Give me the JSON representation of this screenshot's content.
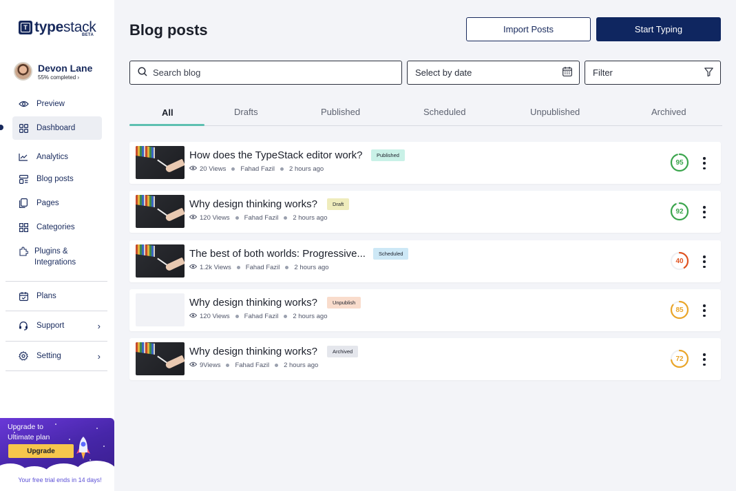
{
  "brand": {
    "name_bold": "type",
    "name_light": "stack",
    "beta": "BETA",
    "logo_letter": "T"
  },
  "profile": {
    "name": "Devon Lane",
    "progress": "55% completed  ›"
  },
  "sidebar": {
    "items": [
      {
        "label": "Preview",
        "icon": "eye-icon"
      },
      {
        "label": "Dashboard",
        "icon": "grid-icon"
      },
      {
        "label": "Analytics",
        "icon": "chart-icon"
      },
      {
        "label": "Blog posts",
        "icon": "blog-icon"
      },
      {
        "label": "Pages",
        "icon": "pages-icon"
      },
      {
        "label": "Categories",
        "icon": "categories-icon"
      },
      {
        "label": "Plugins &\nIntegrations",
        "icon": "plugin-icon"
      },
      {
        "label": "Plans",
        "icon": "calendar-icon"
      },
      {
        "label": "Support",
        "icon": "headset-icon"
      },
      {
        "label": "Setting",
        "icon": "gear-icon"
      }
    ],
    "active": "Dashboard"
  },
  "upgrade": {
    "title": "Upgrade to Ultimate plan",
    "button": "Upgrade",
    "trial": "Your free trial ends in 14 days!"
  },
  "header": {
    "title": "Blog posts",
    "import_label": "Import Posts",
    "start_label": "Start Typing"
  },
  "search": {
    "placeholder": "Search blog"
  },
  "date_select": {
    "label": "Select by date"
  },
  "filter": {
    "label": "Filter"
  },
  "tabs": [
    "All",
    "Drafts",
    "Published",
    "Scheduled",
    "Unpublished",
    "Archived"
  ],
  "active_tab": "All",
  "posts": [
    {
      "title": "How does the TypeStack editor work?",
      "status": "Published",
      "status_color": "#c9f1e7",
      "views": "20 Views",
      "author": "Fahad Fazil",
      "time": "2 hours ago",
      "score": "95",
      "score_value": 95,
      "score_color": "#3aa54c",
      "thumb": true
    },
    {
      "title": "Why design thinking works?",
      "status": "Draft",
      "status_color": "#efecbc",
      "views": "120 Views",
      "author": "Fahad Fazil",
      "time": "2 hours ago",
      "score": "92",
      "score_value": 92,
      "score_color": "#3aa54c",
      "thumb": true
    },
    {
      "title": "The best of both worlds: Progressive...",
      "status": "Scheduled",
      "status_color": "#cde8f6",
      "views": "1.2k Views",
      "author": "Fahad Fazil",
      "time": "2 hours ago",
      "score": "40",
      "score_value": 40,
      "score_color": "#e0521f",
      "thumb": true
    },
    {
      "title": "Why design thinking works?",
      "status": "Unpublish",
      "status_color": "#f9dccc",
      "views": "120 Views",
      "author": "Fahad Fazil",
      "time": "2 hours ago",
      "score": "85",
      "score_value": 85,
      "score_color": "#eaa528",
      "thumb": false
    },
    {
      "title": "Why design thinking works?",
      "status": "Archived",
      "status_color": "#e4e6ec",
      "views": "9Views",
      "author": "Fahad Fazil",
      "time": "2 hours ago",
      "score": "72",
      "score_value": 72,
      "score_color": "#eaa528",
      "thumb": true
    }
  ]
}
